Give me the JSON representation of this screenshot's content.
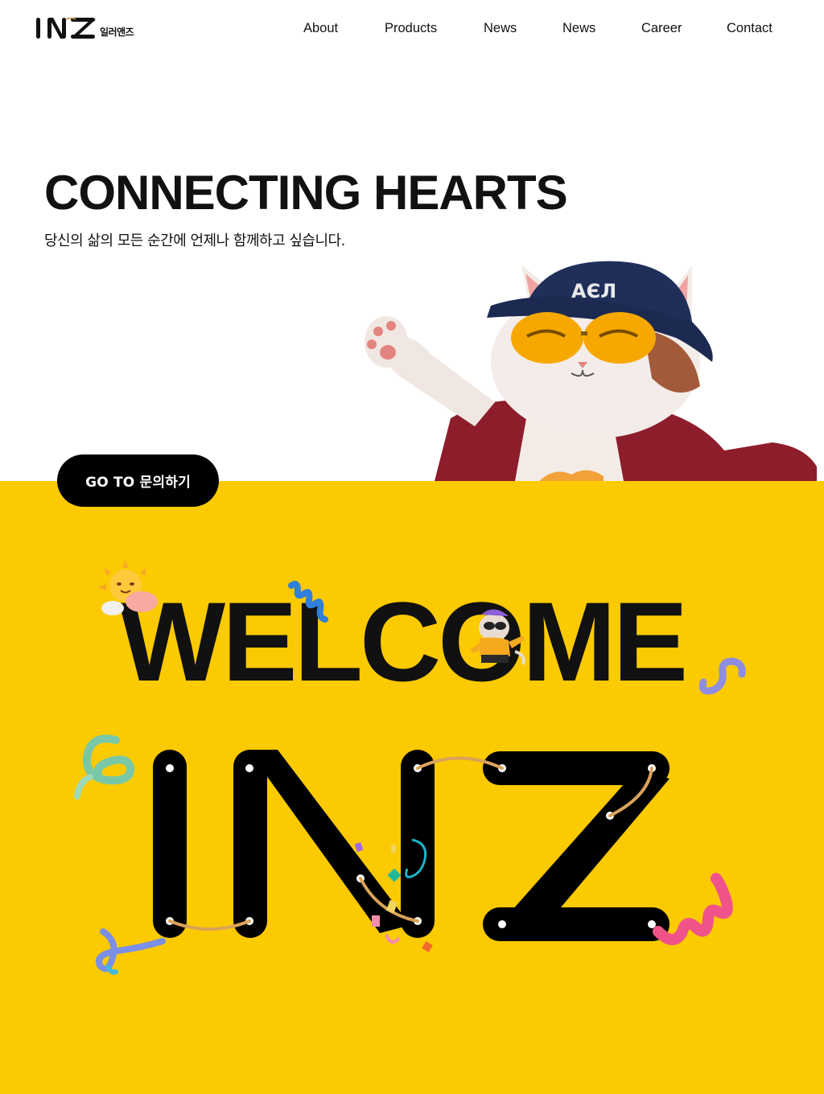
{
  "header": {
    "logo_text": "INZ",
    "logo_sub": "일러앤즈",
    "nav": [
      {
        "label": "About"
      },
      {
        "label": "Products"
      },
      {
        "label": "News"
      },
      {
        "label": "News"
      },
      {
        "label": "Career"
      },
      {
        "label": "Contact"
      }
    ]
  },
  "hero": {
    "title": "CONNECTING HEARTS",
    "subtitle": "당신의 삶의 모든 순간에 언제나 함께하고 싶습니다.",
    "cta_label": "GO TO 문의하기"
  },
  "welcome": {
    "title": "WELCOME",
    "big_logo": "INZ"
  },
  "colors": {
    "accent_yellow": "#fcca00",
    "text_dark": "#111111",
    "button_bg": "#000000"
  },
  "icons": [
    "sun-cloud-icon",
    "blue-spring-icon",
    "cat-character-icon",
    "lavender-squiggle-icon",
    "green-swirl-icon",
    "confetti-icon",
    "blue-ribbon-icon",
    "pink-spring-icon",
    "rope-lace-icon"
  ]
}
